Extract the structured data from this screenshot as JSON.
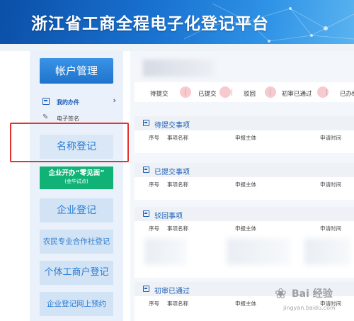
{
  "header": {
    "title": "浙江省工商全程电子化登记平台"
  },
  "sidebar": {
    "account_label": "帐户管理",
    "my_work": "我的办件",
    "esign": "电子签名",
    "name_registration": "名称登记",
    "zero_visit_line1": "企业开办“零见面”",
    "zero_visit_line2": "(金华试点)",
    "enterprise_registration": "企业登记",
    "farmer_coop_registration": "农民专业合作社登记",
    "individual_business_registration": "个体工商户登记",
    "online_appointment": "企业登记网上预约"
  },
  "tabs": [
    "待提交",
    "已提交",
    "驳回",
    "初审已通过",
    "已办结"
  ],
  "sections": [
    {
      "title": "待提交事项",
      "columns": [
        "序号",
        "事项名称",
        "申报主体",
        "申请时间"
      ]
    },
    {
      "title": "已提交事项",
      "columns": [
        "序号",
        "事项名称",
        "申报主体",
        "申请时间"
      ]
    },
    {
      "title": "驳回事项",
      "columns": [
        "序号",
        "事项名称",
        "申报主体",
        "申请时间"
      ]
    },
    {
      "title": "初审已通过",
      "columns": [
        "序号",
        "事项名称",
        "申报主体",
        "申请时间"
      ]
    }
  ],
  "watermark": {
    "brand": "Bai 经验",
    "site": "jingyan.baidu.com"
  },
  "colors": {
    "header_blue": "#1a73d1",
    "highlight_red": "#e5322e",
    "zero_visit_green": "#10b276"
  }
}
